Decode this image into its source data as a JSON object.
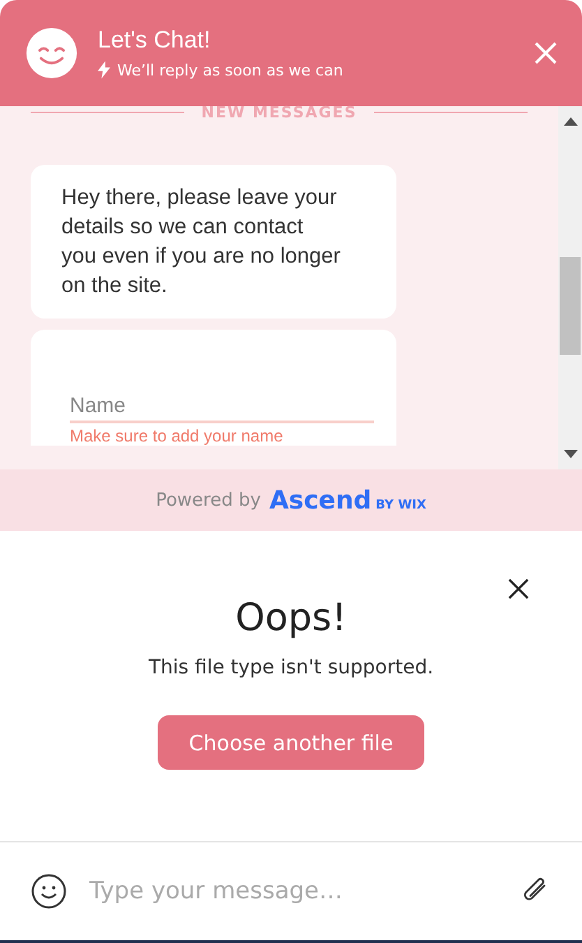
{
  "header": {
    "title": "Let's Chat!",
    "subtitle": "We’ll reply as soon as we can"
  },
  "divider": {
    "label": "NEW MESSAGES"
  },
  "messages": [
    {
      "kind": "text",
      "text": "Hey there, please leave your details so we can contact you even if you are no longer on the site."
    },
    {
      "kind": "form",
      "placeholder": "Name",
      "error": "Make sure to add your name"
    }
  ],
  "footer": {
    "powered_by": "Powered by",
    "brand": "Ascend",
    "brand_suffix": "BY WIX"
  },
  "dialog": {
    "title": "Oops!",
    "message": "This file type isn't supported.",
    "button": "Choose another file"
  },
  "composer": {
    "placeholder": "Type your message…"
  }
}
